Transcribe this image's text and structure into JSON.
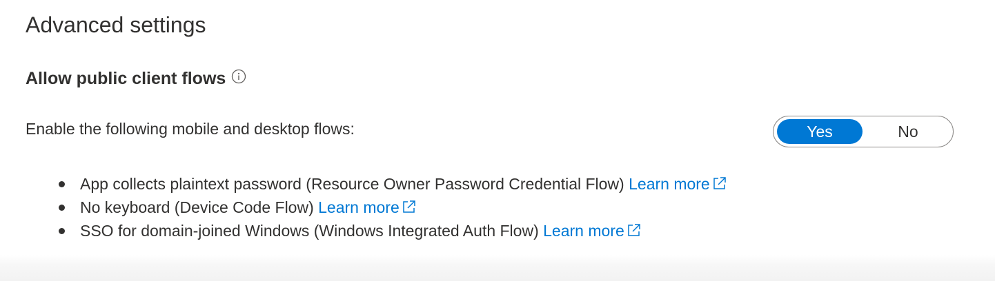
{
  "section": {
    "title": "Advanced settings"
  },
  "public_client_flows": {
    "heading": "Allow public client flows",
    "info_icon": "info-icon",
    "description": "Enable the following mobile and desktop flows:",
    "toggle": {
      "options": [
        "Yes",
        "No"
      ],
      "selected": "Yes"
    },
    "flows": [
      {
        "text": "App collects plaintext password (Resource Owner Password Credential Flow)",
        "link": "Learn more",
        "icon": "external-link-icon"
      },
      {
        "text": "No keyboard (Device Code Flow)",
        "link": "Learn more",
        "icon": "external-link-icon"
      },
      {
        "text": "SSO for domain-joined Windows (Windows Integrated Auth Flow)",
        "link": "Learn more",
        "icon": "external-link-icon"
      }
    ]
  },
  "colors": {
    "accent": "#0078d4",
    "text": "#323130",
    "border": "#8a8886"
  }
}
